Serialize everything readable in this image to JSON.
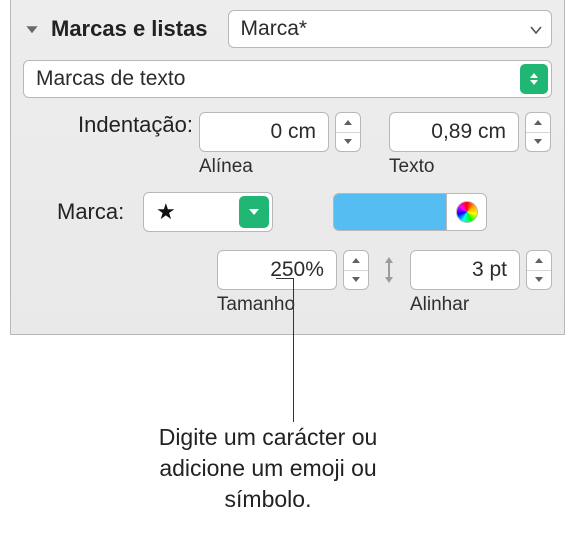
{
  "header": {
    "title": "Marcas e listas",
    "style_dropdown": "Marca*"
  },
  "type_dropdown": "Marcas de texto",
  "indent": {
    "label": "Indentação:",
    "bullet": {
      "value": "0 cm",
      "caption": "Alínea"
    },
    "text": {
      "value": "0,89 cm",
      "caption": "Texto"
    }
  },
  "marca": {
    "label": "Marca:",
    "symbol": "★"
  },
  "size": {
    "value": "250%",
    "caption": "Tamanho"
  },
  "align": {
    "value": "3 pt",
    "caption": "Alinhar"
  },
  "annotation": "Digite um carácter ou adicione um emoji ou símbolo."
}
